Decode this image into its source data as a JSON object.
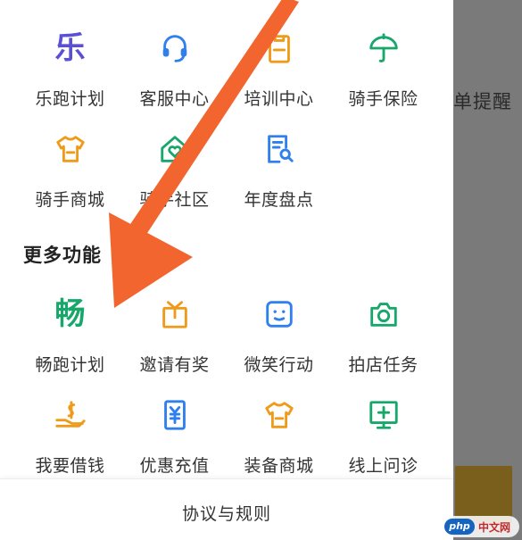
{
  "background": {
    "partial_label": "单提醒"
  },
  "colors": {
    "purple": "#5b4fd6",
    "blue": "#2f7fee",
    "orange": "#f09a1a",
    "green": "#17a76a",
    "arrow": "#f2652e"
  },
  "top_items": [
    {
      "label": "乐跑计划",
      "icon": "le-icon",
      "glyph": "乐",
      "color": "#5b4fd6"
    },
    {
      "label": "客服中心",
      "icon": "headset-icon",
      "color": "#2f7fee"
    },
    {
      "label": "培训中心",
      "icon": "training-box-icon",
      "color": "#f09a1a"
    },
    {
      "label": "骑手保险",
      "icon": "umbrella-icon",
      "color": "#17a76a"
    },
    {
      "label": "骑手商城",
      "icon": "tshirt-icon",
      "color": "#f09a1a"
    },
    {
      "label": "骑手社区",
      "icon": "home-heart-icon",
      "color": "#17a76a"
    },
    {
      "label": "年度盘点",
      "icon": "document-search-icon",
      "color": "#2f7fee"
    }
  ],
  "more_section": {
    "title": "更多功能"
  },
  "more_items": [
    {
      "label": "畅跑计划",
      "icon": "chang-icon",
      "glyph": "畅",
      "color": "#17a76a"
    },
    {
      "label": "邀请有奖",
      "icon": "gift-icon",
      "color": "#f09a1a"
    },
    {
      "label": "微笑行动",
      "icon": "smile-face-icon",
      "color": "#2f7fee"
    },
    {
      "label": "拍店任务",
      "icon": "camera-icon",
      "color": "#17a76a"
    },
    {
      "label": "我要借钱",
      "icon": "hand-money-icon",
      "color": "#f09a1a"
    },
    {
      "label": "优惠充值",
      "icon": "yen-card-icon",
      "color": "#2f7fee"
    },
    {
      "label": "装备商城",
      "icon": "tshirt-icon",
      "color": "#f09a1a"
    },
    {
      "label": "线上问诊",
      "icon": "medical-monitor-icon",
      "color": "#17a76a"
    }
  ],
  "footer": {
    "rules_link": "协议与规则"
  },
  "watermark": {
    "logo": "php",
    "site": "中文网"
  }
}
